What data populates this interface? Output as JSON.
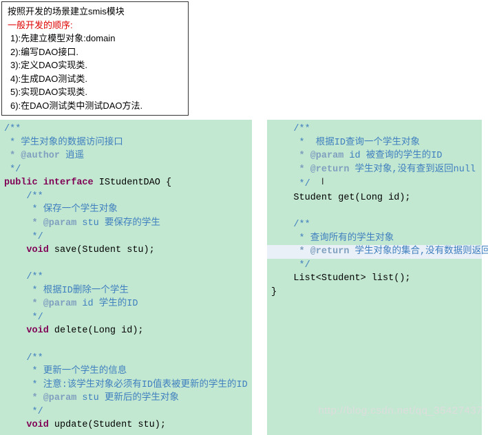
{
  "intro": {
    "line1_a": "按照开发的场景建立",
    "line1_smis": "smis",
    "line1_b": "模块",
    "line2": "一般开发的顺序:",
    "steps": [
      "1):先建立模型对象:domain",
      "2):编写DAO接口.",
      "3):定义DAO实现类.",
      "4):生成DAO测试类.",
      "5):实现DAO实现类.",
      "6):在DAO测试类中测试DAO方法."
    ]
  },
  "left": {
    "doc_open": "/**",
    "doc1": " * 学生对象的数据访问接口",
    "doc2_tag": " * @author ",
    "doc2_txt": "逍遥",
    "doc_close": " */",
    "decl_public": "public",
    "decl_interface": "interface",
    "decl_name": " IStudentDAO {",
    "m1_doc1": " * 保存一个学生对象",
    "m1_doc2_tag": " * @param ",
    "m1_doc2_name": "stu ",
    "m1_doc2_txt": "要保存的学生",
    "m1_void": "void",
    "m1_sig": " save(Student stu);",
    "m2_doc1": " * 根据ID删除一个学生",
    "m2_doc2_tag": " * @param ",
    "m2_doc2_name": "id ",
    "m2_doc2_txt": "学生的ID",
    "m2_void": "void",
    "m2_sig": " delete(Long id);",
    "m3_doc1": " * 更新一个学生的信息",
    "m3_doc2": " * 注意:该学生对象必须有ID值表被更新的学生的ID",
    "m3_doc3_tag": " * @param ",
    "m3_doc3_name": "stu ",
    "m3_doc3_txt": "更新后的学生对象",
    "m3_void": "void",
    "m3_sig": " update(Student stu);"
  },
  "right": {
    "r1_doc1": " *  根据ID查询一个学生对象",
    "r1_doc2_tag": " * @param ",
    "r1_doc2_name": "id ",
    "r1_doc2_txt": "被查询的学生的ID",
    "r1_doc3_tag": " * @return ",
    "r1_doc3_txt": "学生对象,没有查到返回null",
    "r1_sig": "Student get(Long id);",
    "r2_doc1": " * 查询所有的学生对象",
    "r2_doc2_tag": " * @return ",
    "r2_doc2_txt": "学生对象的集合,没有数据则返回空集合",
    "r2_sig": "List<Student> list();",
    "close": "}"
  },
  "watermark": "http://blog.csdn.net/qq_35427437"
}
